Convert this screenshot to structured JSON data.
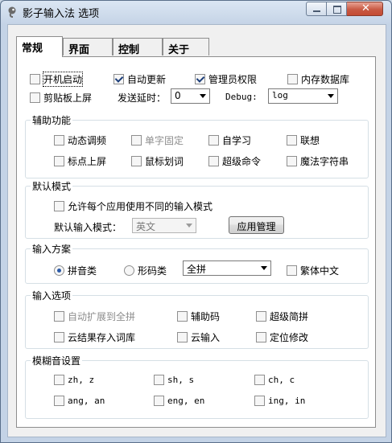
{
  "window": {
    "title": "影子输入法 选项"
  },
  "tabs": [
    "常规",
    "界面",
    "控制",
    "关于"
  ],
  "top": {
    "autostart": "开机启动",
    "auto_update": "自动更新",
    "admin": "管理员权限",
    "memory_db": "内存数据库",
    "clipboard": "剪贴板上屏",
    "send_delay_label": "发送延时：",
    "send_delay_value": "0",
    "debug_label": "Debug:",
    "debug_value": "log"
  },
  "aux": {
    "title": "辅助功能",
    "items": [
      "动态调频",
      "单字固定",
      "自学习",
      "联想",
      "标点上屏",
      "鼠标划词",
      "超级命令",
      "魔法字符串"
    ]
  },
  "mode": {
    "title": "默认模式",
    "per_app": "允许每个应用使用不同的输入模式",
    "default_label": "默认输入模式：",
    "default_value": "英文",
    "app_manage": "应用管理"
  },
  "scheme": {
    "title": "输入方案",
    "pinyin": "拼音类",
    "shape": "形码类",
    "pinyin_value": "全拼",
    "traditional": "繁体中文"
  },
  "options": {
    "title": "输入选项",
    "items": [
      "自动扩展到全拼",
      "辅助码",
      "超级简拼",
      "云结果存入词库",
      "云输入",
      "定位修改"
    ]
  },
  "fuzzy": {
    "title": "模糊音设置",
    "items": [
      "zh, z",
      "sh, s",
      "ch, c",
      "ang, an",
      "eng, en",
      "ing, in"
    ]
  }
}
